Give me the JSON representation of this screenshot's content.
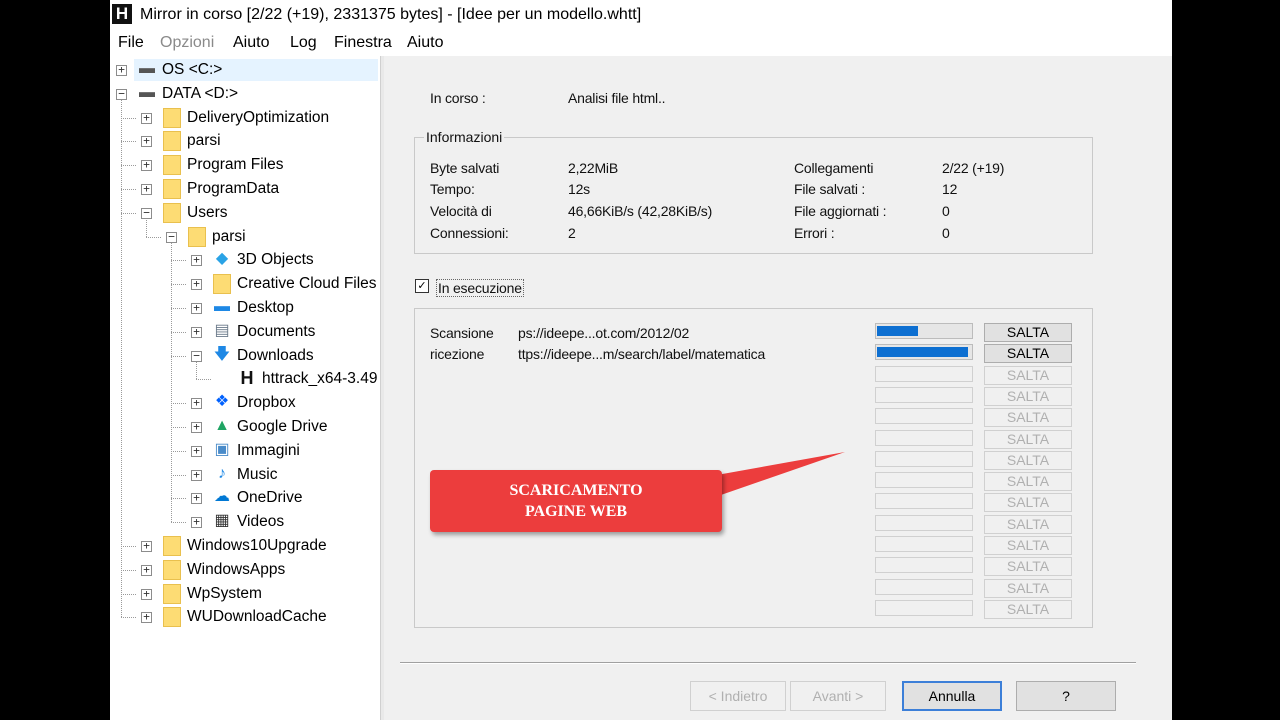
{
  "window": {
    "title": "Mirror in corso [2/22 (+19), 2331375 bytes] - [Idee per un modello.whtt]"
  },
  "menu": [
    "File",
    "Opzioni",
    "Aiuto",
    "Log",
    "Finestra",
    "Aiuto"
  ],
  "tree": [
    {
      "label": "OS <C:>",
      "icon": "drive-icon",
      "selected": true
    },
    {
      "label": "DATA <D:>",
      "icon": "drive-icon"
    },
    {
      "label": "DeliveryOptimization",
      "icon": "folder-icon"
    },
    {
      "label": "parsi",
      "icon": "folder-icon"
    },
    {
      "label": "Program Files",
      "icon": "folder-icon"
    },
    {
      "label": "ProgramData",
      "icon": "folder-icon"
    },
    {
      "label": "Users",
      "icon": "folder-icon"
    },
    {
      "label": "parsi",
      "icon": "folder-icon"
    },
    {
      "label": "3D Objects",
      "icon": "3d-objects-icon"
    },
    {
      "label": "Creative Cloud Files",
      "icon": "folder-icon"
    },
    {
      "label": "Desktop",
      "icon": "desktop-icon"
    },
    {
      "label": "Documents",
      "icon": "documents-icon"
    },
    {
      "label": "Downloads",
      "icon": "download-arrow-icon"
    },
    {
      "label": "httrack_x64-3.49",
      "icon": "httrack-icon"
    },
    {
      "label": "Dropbox",
      "icon": "dropbox-icon"
    },
    {
      "label": "Google Drive",
      "icon": "google-drive-icon"
    },
    {
      "label": "Immagini",
      "icon": "pictures-icon"
    },
    {
      "label": "Music",
      "icon": "music-note-icon"
    },
    {
      "label": "OneDrive",
      "icon": "onedrive-cloud-icon"
    },
    {
      "label": "Videos",
      "icon": "film-icon"
    },
    {
      "label": "Windows10Upgrade",
      "icon": "folder-icon"
    },
    {
      "label": "WindowsApps",
      "icon": "folder-icon"
    },
    {
      "label": "WpSystem",
      "icon": "folder-icon"
    },
    {
      "label": "WUDownloadCache",
      "icon": "folder-icon"
    }
  ],
  "status": {
    "label": "In corso :",
    "value": "Analisi file html.."
  },
  "info": {
    "title": "Informazioni",
    "left": [
      {
        "label": "Byte salvati",
        "value": "2,22MiB"
      },
      {
        "label": "Tempo:",
        "value": "12s"
      },
      {
        "label": "Velocità di",
        "value": "46,66KiB/s (42,28KiB/s)"
      },
      {
        "label": "Connessioni:",
        "value": "2"
      }
    ],
    "right": [
      {
        "label": "Collegamenti",
        "value": "2/22 (+19)"
      },
      {
        "label": "File salvati :",
        "value": "12"
      },
      {
        "label": "File aggiornati :",
        "value": "0"
      },
      {
        "label": "Errori :",
        "value": "0"
      }
    ]
  },
  "running": {
    "label": "In esecuzione",
    "checked": true
  },
  "transfers": [
    {
      "status": "Scansione",
      "url": "ps://ideepe...ot.com/2012/02",
      "progress": 0.44,
      "enabled": true
    },
    {
      "status": "ricezione",
      "url": "ttps://ideepe...m/search/label/matematica",
      "progress": 0.97,
      "enabled": true
    },
    {
      "status": "",
      "url": "",
      "progress": 0,
      "enabled": false
    },
    {
      "status": "",
      "url": "",
      "progress": 0,
      "enabled": false
    },
    {
      "status": "",
      "url": "",
      "progress": 0,
      "enabled": false
    },
    {
      "status": "",
      "url": "",
      "progress": 0,
      "enabled": false
    },
    {
      "status": "",
      "url": "",
      "progress": 0,
      "enabled": false
    },
    {
      "status": "",
      "url": "",
      "progress": 0,
      "enabled": false
    },
    {
      "status": "",
      "url": "",
      "progress": 0,
      "enabled": false
    },
    {
      "status": "",
      "url": "",
      "progress": 0,
      "enabled": false
    },
    {
      "status": "",
      "url": "",
      "progress": 0,
      "enabled": false
    },
    {
      "status": "",
      "url": "",
      "progress": 0,
      "enabled": false
    },
    {
      "status": "",
      "url": "",
      "progress": 0,
      "enabled": false
    },
    {
      "status": "",
      "url": "",
      "progress": 0,
      "enabled": false
    }
  ],
  "skip_label": "SALTA",
  "buttons": {
    "back": "< Indietro",
    "next": "Avanti >",
    "cancel": "Annulla",
    "help": "?"
  },
  "callout": {
    "text": "SCARICAMENTO\nPAGINE WEB"
  },
  "colors": {
    "progress": "#0d6fd1",
    "callout": "#ec3d3d"
  }
}
